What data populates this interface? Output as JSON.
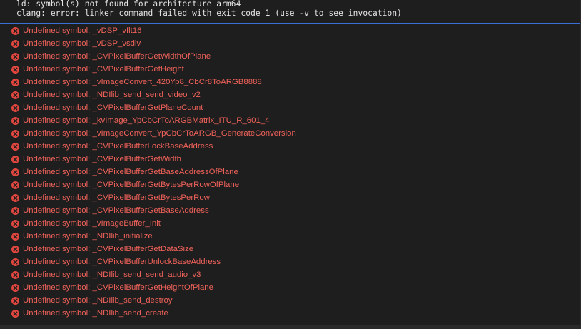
{
  "log": {
    "lines": [
      "ld: symbol(s) not found for architecture arm64",
      "clang: error: linker command failed with exit code 1 (use -v to see invocation)"
    ]
  },
  "issues": {
    "icon": "error-icon",
    "icon_color": "#e2473f",
    "text_color": "#f0625a",
    "items": [
      "Undefined symbol: _vDSP_vflt16",
      "Undefined symbol: _vDSP_vsdiv",
      "Undefined symbol: _CVPixelBufferGetWidthOfPlane",
      "Undefined symbol: _CVPixelBufferGetHeight",
      "Undefined symbol: _vImageConvert_420Yp8_CbCr8ToARGB8888",
      "Undefined symbol: _NDIlib_send_send_video_v2",
      "Undefined symbol: _CVPixelBufferGetPlaneCount",
      "Undefined symbol: _kvImage_YpCbCrToARGBMatrix_ITU_R_601_4",
      "Undefined symbol: _vImageConvert_YpCbCrToARGB_GenerateConversion",
      "Undefined symbol: _CVPixelBufferLockBaseAddress",
      "Undefined symbol: _CVPixelBufferGetWidth",
      "Undefined symbol: _CVPixelBufferGetBaseAddressOfPlane",
      "Undefined symbol: _CVPixelBufferGetBytesPerRowOfPlane",
      "Undefined symbol: _CVPixelBufferGetBytesPerRow",
      "Undefined symbol: _CVPixelBufferGetBaseAddress",
      "Undefined symbol: _vImageBuffer_Init",
      "Undefined symbol: _NDIlib_initialize",
      "Undefined symbol: _CVPixelBufferGetDataSize",
      "Undefined symbol: _CVPixelBufferUnlockBaseAddress",
      "Undefined symbol: _NDIlib_send_send_audio_v3",
      "Undefined symbol: _CVPixelBufferGetHeightOfPlane",
      "Undefined symbol: _NDIlib_send_destroy",
      "Undefined symbol: _NDIlib_send_create"
    ]
  }
}
